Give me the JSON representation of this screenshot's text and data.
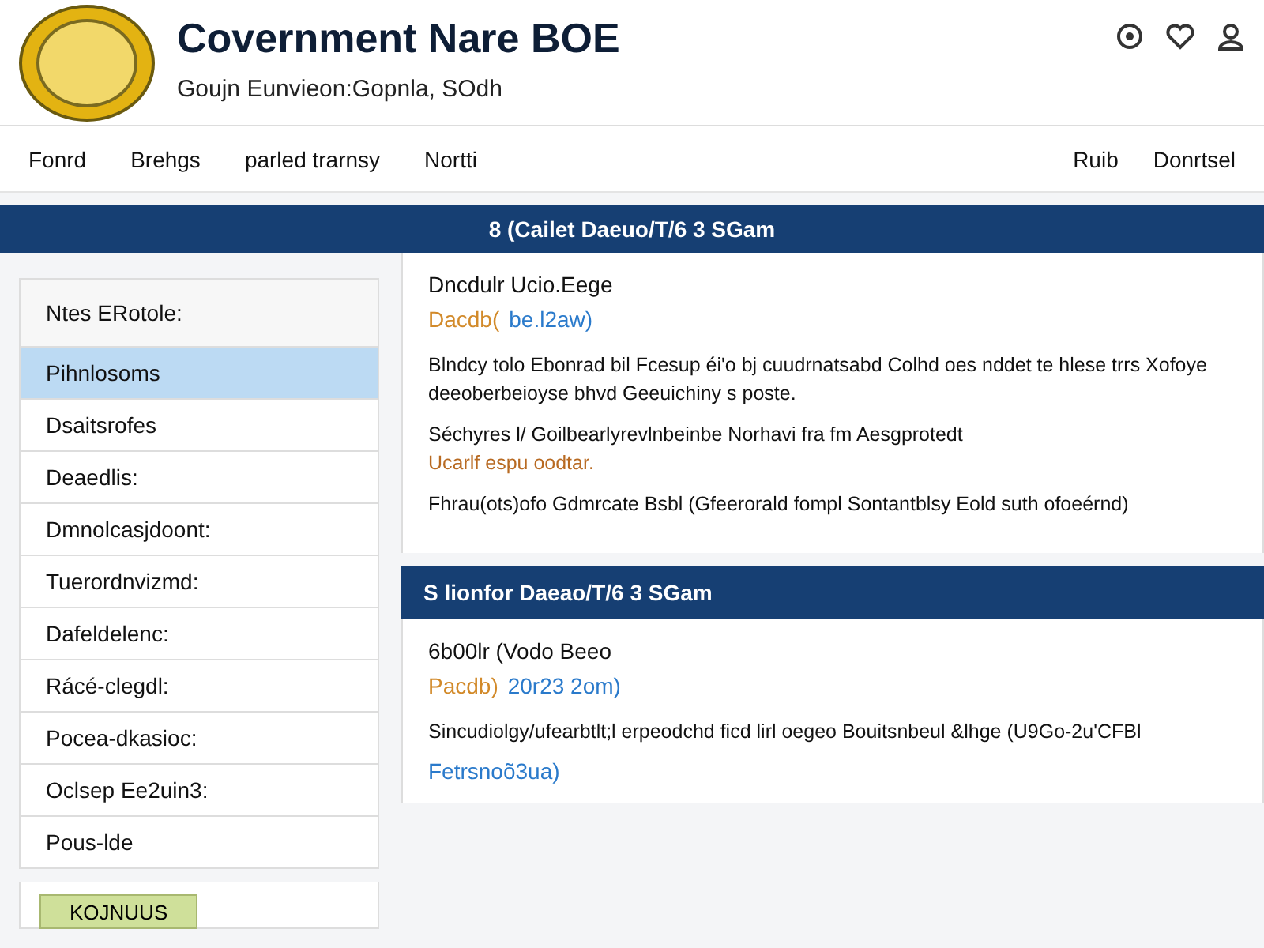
{
  "header": {
    "title": "Covernment Nare BOE",
    "subtitle": "Goujn Eunvieon:Gopnla, SOdh"
  },
  "nav": {
    "left": [
      "Fonrd",
      "Brehgs",
      "parled trarnsy",
      "Nortti"
    ],
    "right": [
      "Ruib",
      "Donrtsel"
    ]
  },
  "banner": {
    "title": "8 (Cailet Daeuo/T/6 3 SGam"
  },
  "sidebar": {
    "heading": "Ntes ERotole:",
    "items": [
      {
        "label": "Pihnlosoms",
        "selected": true
      },
      {
        "label": "Dsaitsrofes",
        "selected": false
      },
      {
        "label": "Deaedlis:",
        "selected": false
      },
      {
        "label": "Dmnolcasjdoont:",
        "selected": false
      },
      {
        "label": "Tuerordnvizmd:",
        "selected": false
      },
      {
        "label": "Dafeldelenc:",
        "selected": false
      },
      {
        "label": "Rácé-clegdl:",
        "selected": false
      },
      {
        "label": "Pocea-dkasioc:",
        "selected": false
      },
      {
        "label": "Oclsep Ee2uin3:",
        "selected": false
      },
      {
        "label": "Pous-lde",
        "selected": false
      }
    ],
    "button": "KOJNUUS"
  },
  "articles": [
    {
      "title": "Dncdulr Ucio.Eege",
      "meta_label": "Dacdb(",
      "meta_date": "be.l2aw)",
      "paragraphs": [
        {
          "text": "Blndcy tolo Ebonrad bil Fcesup éi'o bj cuudrnatsabd Colhd oes nddet te hlese trrs Xofoye deeoberbeioyse bhvd Geeuichiny s poste."
        },
        {
          "text": "Séchyres l/ Goilbearlyrevlnbeinbe Norhavi fra fm Aesgprotedt",
          "highlight": "Ucarlf espu oodtar."
        },
        {
          "text": "Fhrau(ots)ofo Gdmrcate Bsbl (Gfeerorald fompl Sontantblsy Eold suth ofoeérnd)"
        }
      ]
    },
    {
      "heading": "S lionfor Daeao/T/6 3 SGam",
      "title": "6b00lr (Vodo Beeo",
      "meta_label": "Pacdb)",
      "meta_date": "20r23 2om)",
      "paragraphs": [
        {
          "text": "Sincudiolgy/ufearbtlt;l erpeodchd ficd lirl oegeo Bouitsnbeul &lhge (U9Go-2u'CFBl"
        }
      ],
      "link": "Fetrsnoõ3ua)"
    }
  ]
}
